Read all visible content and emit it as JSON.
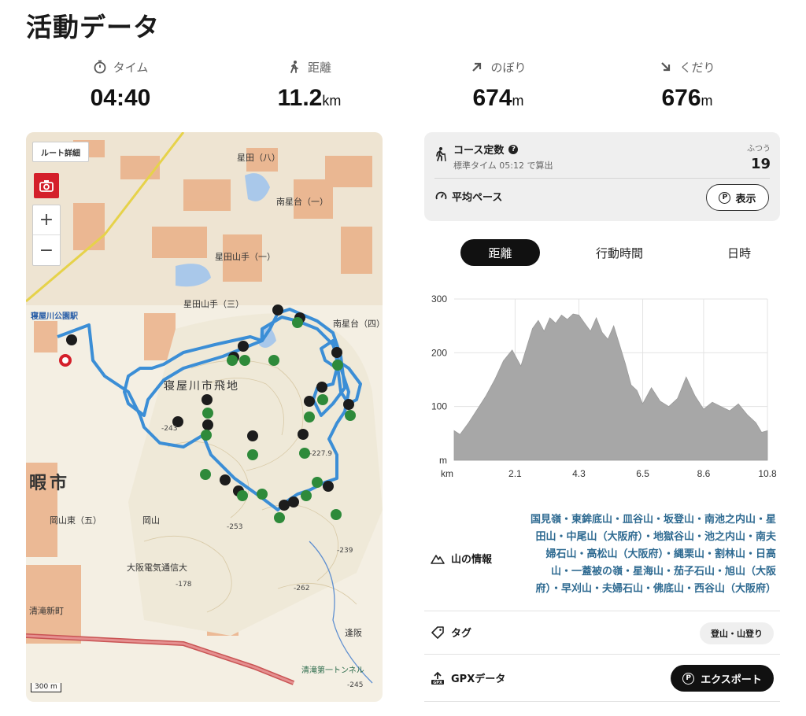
{
  "page": {
    "title": "活動データ"
  },
  "stats": [
    {
      "label": "タイム",
      "value": "04:40",
      "unit": "",
      "icon": "stopwatch-icon"
    },
    {
      "label": "距離",
      "value": "11.2",
      "unit": "km",
      "icon": "walker-icon"
    },
    {
      "label": "のぼり",
      "value": "674",
      "unit": "m",
      "icon": "arrow-up-right-icon"
    },
    {
      "label": "くだり",
      "value": "676",
      "unit": "m",
      "icon": "arrow-down-right-icon"
    }
  ],
  "map": {
    "route_detail_label": "ルート詳細",
    "zoom_in": "+",
    "zoom_out": "−",
    "scale_label": "300 m",
    "route_color": "#3b8ed6",
    "place_labels": [
      "寝屋川公園駅",
      "寝屋川市飛地",
      "星田山手（三）",
      "星田山手（一）",
      "南星台（一）",
      "南星台（四）",
      "星田（八）",
      "岡山",
      "大阪電気通信大",
      "清滝新町",
      "清滝第一トンネル",
      "逢阪",
      "岡山東（五）",
      "暇市",
      "-253",
      "-239",
      "-178",
      "-262",
      "-245",
      "-243",
      "-227.9"
    ]
  },
  "course": {
    "title": "コース定数",
    "subtitle": "標準タイム 05:12 で算出",
    "level_label": "ふつう",
    "value": "19",
    "pace_label": "平均ペース",
    "show_button": "表示"
  },
  "tabs": [
    {
      "label": "距離",
      "active": true
    },
    {
      "label": "行動時間",
      "active": false
    },
    {
      "label": "日時",
      "active": false
    }
  ],
  "chart_data": {
    "type": "area",
    "xlabel": "km",
    "ylabel": "m",
    "x_ticks": [
      "2.1",
      "4.3",
      "6.5",
      "8.6",
      "10.8"
    ],
    "y_ticks": [
      "100",
      "200",
      "300"
    ],
    "xlim": [
      0,
      10.8
    ],
    "ylim": [
      0,
      300
    ],
    "fill_color": "#a7a7a7",
    "x": [
      0,
      0.2,
      0.5,
      0.8,
      1.1,
      1.4,
      1.7,
      2.0,
      2.3,
      2.5,
      2.7,
      2.9,
      3.1,
      3.3,
      3.5,
      3.7,
      3.9,
      4.1,
      4.3,
      4.5,
      4.7,
      4.9,
      5.1,
      5.3,
      5.5,
      5.7,
      5.9,
      6.1,
      6.3,
      6.5,
      6.8,
      7.1,
      7.4,
      7.7,
      8.0,
      8.3,
      8.6,
      8.9,
      9.2,
      9.5,
      9.8,
      10.1,
      10.4,
      10.6,
      10.8
    ],
    "y": [
      55,
      48,
      70,
      95,
      120,
      150,
      185,
      205,
      175,
      210,
      245,
      260,
      240,
      265,
      255,
      270,
      262,
      272,
      270,
      255,
      240,
      265,
      238,
      225,
      250,
      215,
      180,
      140,
      130,
      105,
      135,
      110,
      100,
      115,
      155,
      120,
      95,
      108,
      100,
      92,
      105,
      85,
      70,
      52,
      55
    ]
  },
  "mountain_info": {
    "label": "山の情報",
    "lines": [
      "国見嶺・東鉾底山・皿谷山・坂登山・南池之内山・星",
      "田山・中尾山（大阪府）・地獄谷山・池之内山・南夫",
      "婦石山・高松山（大阪府）・縄栗山・割林山・日高",
      "山・一蓋被の嶺・星海山・茄子石山・旭山（大阪",
      "府）・早刈山・夫婦石山・佛底山・西谷山（大阪府）"
    ]
  },
  "tags": {
    "label": "タグ",
    "value": "登山・山登り"
  },
  "gpx": {
    "label": "GPXデータ",
    "export_button": "エクスポート"
  }
}
